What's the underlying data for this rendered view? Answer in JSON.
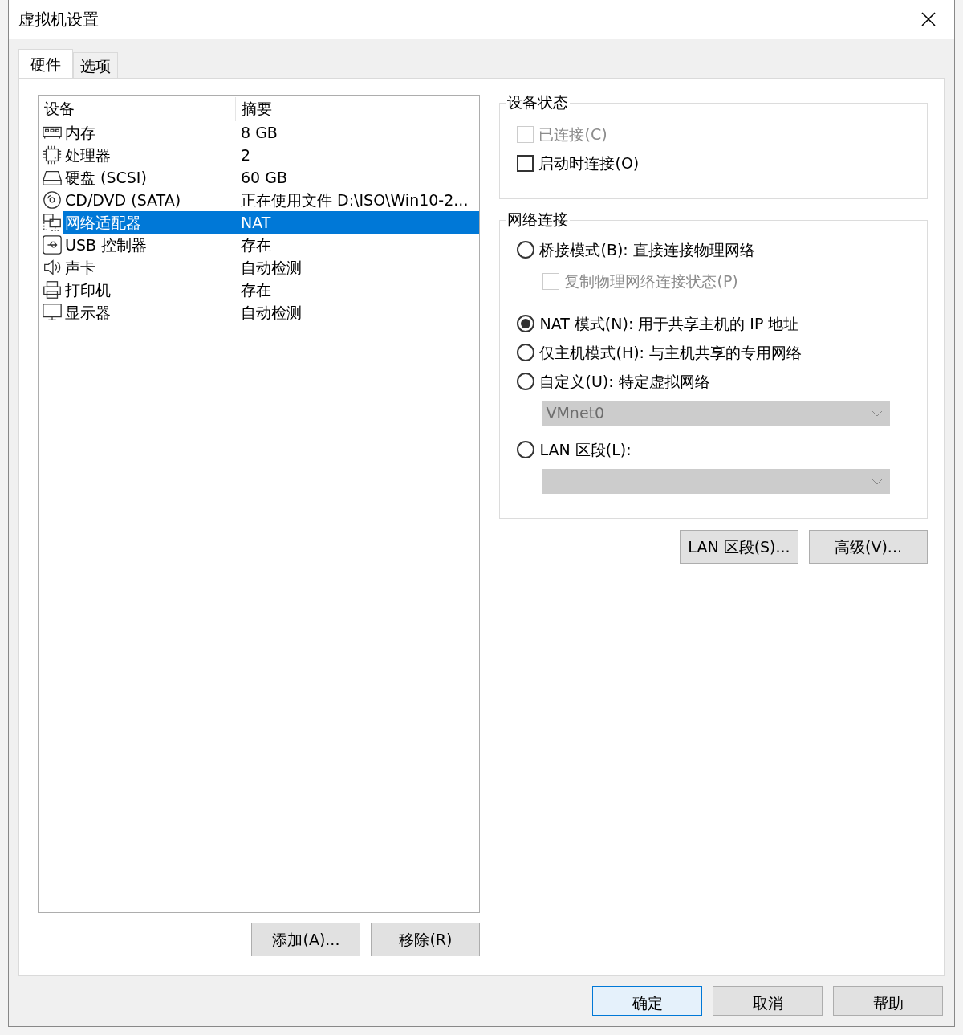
{
  "window": {
    "title": "虚拟机设置"
  },
  "tabs": [
    {
      "label": "硬件",
      "selected": true
    },
    {
      "label": "选项",
      "selected": false
    }
  ],
  "devices": {
    "columns": [
      "设备",
      "摘要"
    ],
    "rows": [
      {
        "kind": "memory",
        "name": "内存",
        "summary": "8 GB",
        "selected": false
      },
      {
        "kind": "cpu",
        "name": "处理器",
        "summary": "2",
        "selected": false
      },
      {
        "kind": "disk",
        "name": "硬盘 (SCSI)",
        "summary": "60 GB",
        "selected": false
      },
      {
        "kind": "cdrom",
        "name": "CD/DVD (SATA)",
        "summary": "正在使用文件 D:\\ISO\\Win10-2...",
        "selected": false
      },
      {
        "kind": "network",
        "name": "网络适配器",
        "summary": "NAT",
        "selected": true
      },
      {
        "kind": "usb",
        "name": "USB 控制器",
        "summary": "存在",
        "selected": false
      },
      {
        "kind": "sound",
        "name": "声卡",
        "summary": "自动检测",
        "selected": false
      },
      {
        "kind": "printer",
        "name": "打印机",
        "summary": "存在",
        "selected": false
      },
      {
        "kind": "display",
        "name": "显示器",
        "summary": "自动检测",
        "selected": false
      }
    ],
    "buttons": [
      "添加(A)...",
      "移除(R)"
    ]
  },
  "device_status": {
    "title": "设备状态",
    "checkboxes": [
      {
        "label": "已连接(C)",
        "checked": false,
        "disabled": true
      },
      {
        "label": "启动时连接(O)",
        "checked": false,
        "disabled": false
      }
    ]
  },
  "network": {
    "title": "网络连接",
    "options": [
      {
        "kind": "radio",
        "label": "桥接模式(B): 直接连接物理网络",
        "selected": false
      },
      {
        "kind": "checkbox",
        "label": "复制物理网络连接状态(P)",
        "checked": false,
        "disabled": true
      },
      {
        "kind": "radio",
        "label": "NAT 模式(N): 用于共享主机的 IP 地址",
        "selected": true
      },
      {
        "kind": "radio",
        "label": "仅主机模式(H): 与主机共享的专用网络",
        "selected": false
      },
      {
        "kind": "radio",
        "label": "自定义(U): 特定虚拟网络",
        "selected": false
      },
      {
        "kind": "select",
        "value": "VMnet0",
        "disabled": true
      },
      {
        "kind": "radio",
        "label": "LAN 区段(L):",
        "selected": false
      },
      {
        "kind": "select",
        "disabled": true
      }
    ],
    "buttons": [
      "LAN 区段(S)...",
      "高级(V)..."
    ]
  },
  "footer_buttons": [
    {
      "label": "确定",
      "default": true
    },
    {
      "label": "取消",
      "default": false
    },
    {
      "label": "帮助",
      "default": false
    }
  ]
}
